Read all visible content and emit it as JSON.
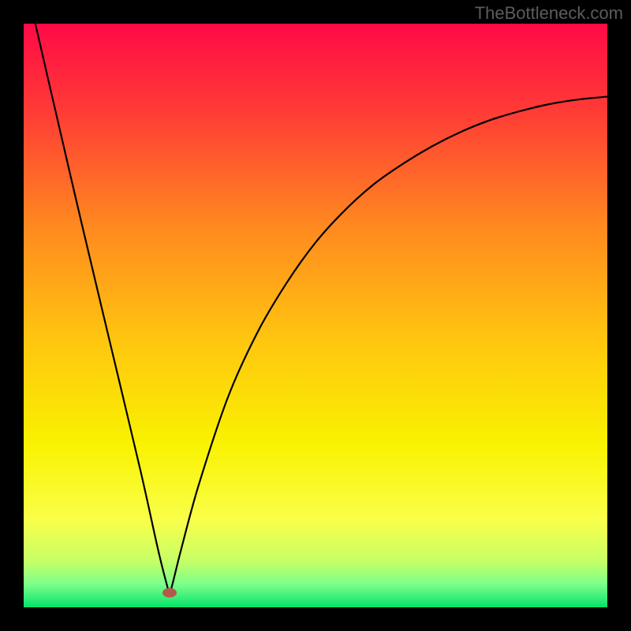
{
  "watermark": "TheBottleneck.com",
  "chart_data": {
    "type": "line",
    "title": "",
    "xlabel": "",
    "ylabel": "",
    "xlim": [
      0,
      100
    ],
    "ylim": [
      0,
      100
    ],
    "grid": false,
    "legend": false,
    "background": {
      "type": "vertical-gradient",
      "stops": [
        {
          "offset": 0.0,
          "color": "#ff0a46"
        },
        {
          "offset": 0.15,
          "color": "#ff3b36"
        },
        {
          "offset": 0.35,
          "color": "#ff8a1f"
        },
        {
          "offset": 0.55,
          "color": "#ffc80f"
        },
        {
          "offset": 0.72,
          "color": "#f9f200"
        },
        {
          "offset": 0.85,
          "color": "#f9ff4a"
        },
        {
          "offset": 0.92,
          "color": "#c7ff66"
        },
        {
          "offset": 0.96,
          "color": "#7dff8a"
        },
        {
          "offset": 1.0,
          "color": "#05e36b"
        }
      ]
    },
    "curve": {
      "color": "#000000",
      "width": 2.2,
      "minimum_marker": {
        "x": 25,
        "y": 2.5,
        "color": "#b55a4a"
      },
      "points": [
        {
          "x": 2.0,
          "y": 100.0
        },
        {
          "x": 5.0,
          "y": 87.0
        },
        {
          "x": 10.0,
          "y": 65.5
        },
        {
          "x": 15.0,
          "y": 44.5
        },
        {
          "x": 20.0,
          "y": 23.5
        },
        {
          "x": 23.0,
          "y": 10.0
        },
        {
          "x": 24.5,
          "y": 4.0
        },
        {
          "x": 25.0,
          "y": 2.5
        },
        {
          "x": 25.5,
          "y": 4.0
        },
        {
          "x": 27.0,
          "y": 10.0
        },
        {
          "x": 30.0,
          "y": 21.0
        },
        {
          "x": 35.0,
          "y": 36.0
        },
        {
          "x": 40.0,
          "y": 47.0
        },
        {
          "x": 45.0,
          "y": 55.5
        },
        {
          "x": 50.0,
          "y": 62.5
        },
        {
          "x": 55.0,
          "y": 68.0
        },
        {
          "x": 60.0,
          "y": 72.5
        },
        {
          "x": 65.0,
          "y": 76.0
        },
        {
          "x": 70.0,
          "y": 79.0
        },
        {
          "x": 75.0,
          "y": 81.5
        },
        {
          "x": 80.0,
          "y": 83.5
        },
        {
          "x": 85.0,
          "y": 85.0
        },
        {
          "x": 90.0,
          "y": 86.2
        },
        {
          "x": 95.0,
          "y": 87.0
        },
        {
          "x": 100.0,
          "y": 87.5
        }
      ]
    }
  }
}
